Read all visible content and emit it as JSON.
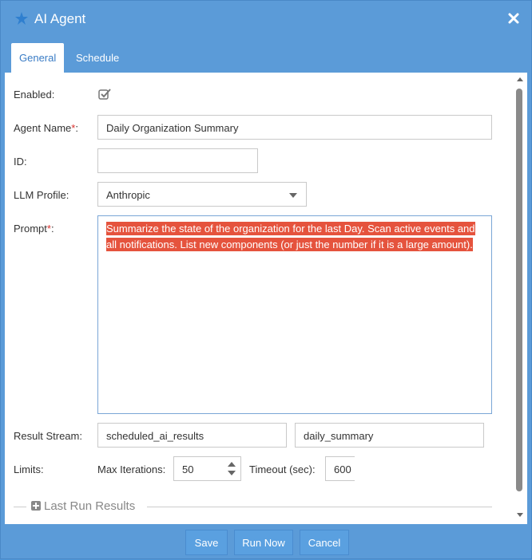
{
  "dialog": {
    "title": "AI Agent",
    "title_icon": "star-icon",
    "close_icon": "close-icon"
  },
  "tabs": [
    {
      "label": "General",
      "active": true
    },
    {
      "label": "Schedule",
      "active": false
    }
  ],
  "form": {
    "enabled": {
      "label": "Enabled:",
      "checked": true
    },
    "agent_name": {
      "label": "Agent Name",
      "required_mark": "*",
      "suffix": ":",
      "value": "Daily Organization Summary"
    },
    "id": {
      "label": "ID:",
      "value": ""
    },
    "llm_profile": {
      "label": "LLM Profile:",
      "value": "Anthropic"
    },
    "prompt": {
      "label": "Prompt",
      "required_mark": "*",
      "suffix": ":",
      "value": "Summarize the state of the organization for the last Day. Scan active events and all notifications. List new components (or just the number if it is a large amount)."
    },
    "result_stream": {
      "label": "Result Stream:",
      "value1": "scheduled_ai_results",
      "value2": "daily_summary"
    },
    "limits": {
      "label": "Limits:",
      "max_iterations_label": "Max Iterations:",
      "max_iterations_value": "50",
      "timeout_label": "Timeout (sec):",
      "timeout_value": "600"
    },
    "last_run_results": "Last Run Results"
  },
  "footer": {
    "save": "Save",
    "run_now": "Run Now",
    "cancel": "Cancel"
  },
  "colors": {
    "titlebar": "#5b9bd8",
    "selection": "#e5533d",
    "button": "#5aa0e0",
    "required": "#d9302c"
  }
}
